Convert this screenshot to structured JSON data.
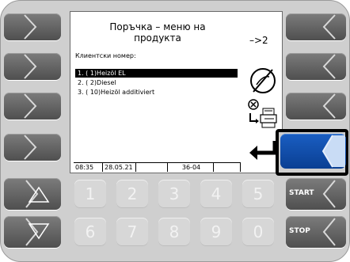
{
  "screen": {
    "title_line1": "Поръчка – меню на",
    "title_line2": "продукта",
    "page_indicator": "–>2",
    "customer_label": "Клиентски номер:",
    "products": [
      "1.  (  1)Heizöl EL",
      "2.  (  2)Diesel",
      "3.  ( 10)Heizöl additiviert"
    ],
    "status_bar": {
      "time": "08:35",
      "date": "28.05.21",
      "field3": "",
      "code": "36-04",
      "field5": ""
    }
  },
  "icons": {
    "no_entry": "circle-slash-icon",
    "cancel_print": "cancel-print-icon",
    "enter": "enter-arrow-icon"
  },
  "numpad": [
    "1",
    "2",
    "3",
    "4",
    "5",
    "6",
    "7",
    "8",
    "9",
    "0"
  ],
  "right_keys": {
    "start_label": "START",
    "stop_label": "STOP"
  },
  "colors": {
    "active_key": "#0a49a8",
    "key_gray": "#5f5f5f"
  }
}
